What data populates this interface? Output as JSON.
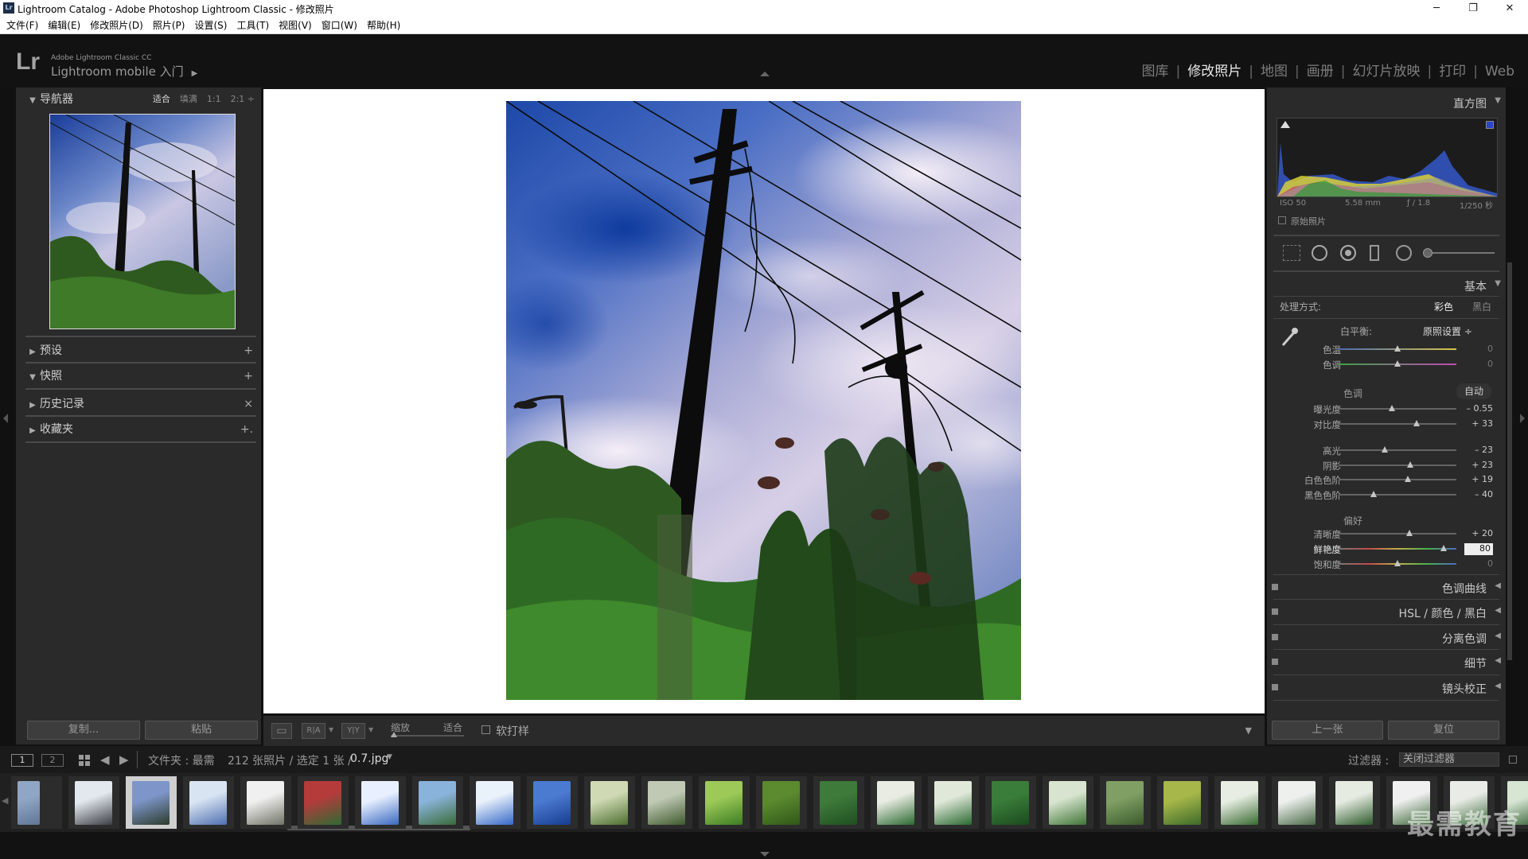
{
  "window": {
    "title": "Lightroom Catalog - Adobe Photoshop Lightroom Classic - 修改照片",
    "app_icon": "Lr",
    "controls": [
      "minimize-icon",
      "restore-icon",
      "close-icon"
    ],
    "control_glyphs": [
      "─",
      "❐",
      "✕"
    ]
  },
  "menu": [
    "文件(F)",
    "编辑(E)",
    "修改照片(D)",
    "照片(P)",
    "设置(S)",
    "工具(T)",
    "视图(V)",
    "窗口(W)",
    "帮助(H)"
  ],
  "identity": {
    "logo": "Lr",
    "product_small": "Adobe Lightroom Classic CC",
    "product_big": "Lightroom mobile 入门",
    "arrow": "▶"
  },
  "modules": [
    {
      "label": "图库",
      "active": false
    },
    {
      "label": "修改照片",
      "active": true
    },
    {
      "label": "地图",
      "active": false
    },
    {
      "label": "画册",
      "active": false
    },
    {
      "label": "幻灯片放映",
      "active": false
    },
    {
      "label": "打印",
      "active": false
    },
    {
      "label": "Web",
      "active": false
    }
  ],
  "left_panel": {
    "navigator": {
      "title": "导航器",
      "options": [
        "适合",
        "填满",
        "1:1",
        "2:1 ÷"
      ],
      "active_option": "适合"
    },
    "sections": [
      {
        "title": "预设",
        "tri": "▶",
        "action": "+"
      },
      {
        "title": "快照",
        "tri": "▼",
        "action": "+"
      },
      {
        "title": "历史记录",
        "tri": "▶",
        "action": "×"
      },
      {
        "title": "收藏夹",
        "tri": "▶",
        "action": "+."
      }
    ],
    "copy_label": "复制...",
    "paste_label": "粘贴"
  },
  "toolbar": {
    "view_loupe": "▭",
    "view_ra": "R|A",
    "view_yy": "Y|Y",
    "zoom_label": "缩放",
    "zoom_value": "适合",
    "softproof_label": "软打样",
    "dropdown_arrow": "▼"
  },
  "right_panel": {
    "histogram": {
      "title": "直方图",
      "iso": "ISO 50",
      "focal": "5.58 mm",
      "aperture": "ƒ / 1.8",
      "shutter": "1/250 秒",
      "original_label": "原始照片"
    },
    "basic": {
      "title": "基本",
      "treatment_label": "处理方式:",
      "treatment_color": "彩色",
      "treatment_bw": "黑白",
      "wb_label": "白平衡:",
      "wb_value": "原照设置 ÷",
      "tone_label": "色调",
      "auto_label": "自动",
      "presence_label": "偏好",
      "sliders": [
        {
          "name": "色温",
          "value": "0",
          "pos": 0.5,
          "group": "wb"
        },
        {
          "name": "色调",
          "value": "0",
          "pos": 0.5,
          "group": "wb"
        },
        {
          "name": "曝光度",
          "value": "– 0.55",
          "pos": 0.45,
          "group": "tone"
        },
        {
          "name": "对比度",
          "value": "+ 33",
          "pos": 0.66,
          "group": "tone"
        },
        {
          "name": "高光",
          "value": "– 23",
          "pos": 0.39,
          "group": "tone2"
        },
        {
          "name": "阴影",
          "value": "+ 23",
          "pos": 0.61,
          "group": "tone2"
        },
        {
          "name": "白色色阶",
          "value": "+ 19",
          "pos": 0.59,
          "group": "tone2"
        },
        {
          "name": "黑色色阶",
          "value": "– 40",
          "pos": 0.3,
          "group": "tone2"
        },
        {
          "name": "清晰度",
          "value": "+ 20",
          "pos": 0.6,
          "group": "presence"
        },
        {
          "name": "鲜艳度",
          "value": "80",
          "pos": 0.89,
          "group": "presence"
        },
        {
          "name": "饱和度",
          "value": "0",
          "pos": 0.5,
          "group": "presence"
        }
      ]
    },
    "collapsed_sections": [
      "色调曲线",
      "HSL / 颜色 / 黑白",
      "分离色调",
      "细节",
      "镜头校正"
    ],
    "prev_label": "上一张",
    "reset_label": "复位"
  },
  "filmbar": {
    "page1": "1",
    "page2": "2",
    "source": "文件夹 : 最需",
    "count": "212 张照片 / 选定 1 张 /",
    "filename": "0.7.jpg",
    "filter_label": "过滤器 :",
    "filter_value": "关闭过滤器"
  },
  "filmstrip": {
    "selected_index": 2,
    "colors": [
      [
        "#8fa6c4",
        "#5f7794"
      ],
      [
        "#e3e7ee",
        "#3b3f45"
      ],
      [
        "#7d95c8",
        "#2b3b2a"
      ],
      [
        "#d9e4f3",
        "#4e6fb0"
      ],
      [
        "#f0f0f0",
        "#707366"
      ],
      [
        "#b53b3b",
        "#2f6a33"
      ],
      [
        "#e8f0ff",
        "#3868c0"
      ],
      [
        "#89b3da",
        "#3a6b38"
      ],
      [
        "#e9f1fb",
        "#3568c7"
      ],
      [
        "#4b7ad1",
        "#163d8f"
      ],
      [
        "#cfd9b3",
        "#4c6e2e"
      ],
      [
        "#bfc9b4",
        "#3e5a2d"
      ],
      [
        "#9cc958",
        "#3c7d22"
      ],
      [
        "#5c8a2f",
        "#2f5818"
      ],
      [
        "#3e7a3a",
        "#1f4f20"
      ],
      [
        "#e9ece3",
        "#2b6a30"
      ],
      [
        "#e0e8da",
        "#2a6a31"
      ],
      [
        "#3a7d3a",
        "#1b4b1d"
      ],
      [
        "#d8e4cf",
        "#3e7636"
      ],
      [
        "#7f9f64",
        "#3b5b2c"
      ],
      [
        "#a7b74a",
        "#3c6a2a"
      ],
      [
        "#e7ede2",
        "#376a30"
      ],
      [
        "#eef0ee",
        "#4a6b47"
      ],
      [
        "#e6ebe2",
        "#2c5b2b"
      ],
      [
        "#f0f0f0",
        "#3a6635"
      ],
      [
        "#e9ece6",
        "#3c6a3b"
      ],
      [
        "#d6e6d3",
        "#2f5a2e"
      ]
    ]
  },
  "watermark": "最需教育"
}
